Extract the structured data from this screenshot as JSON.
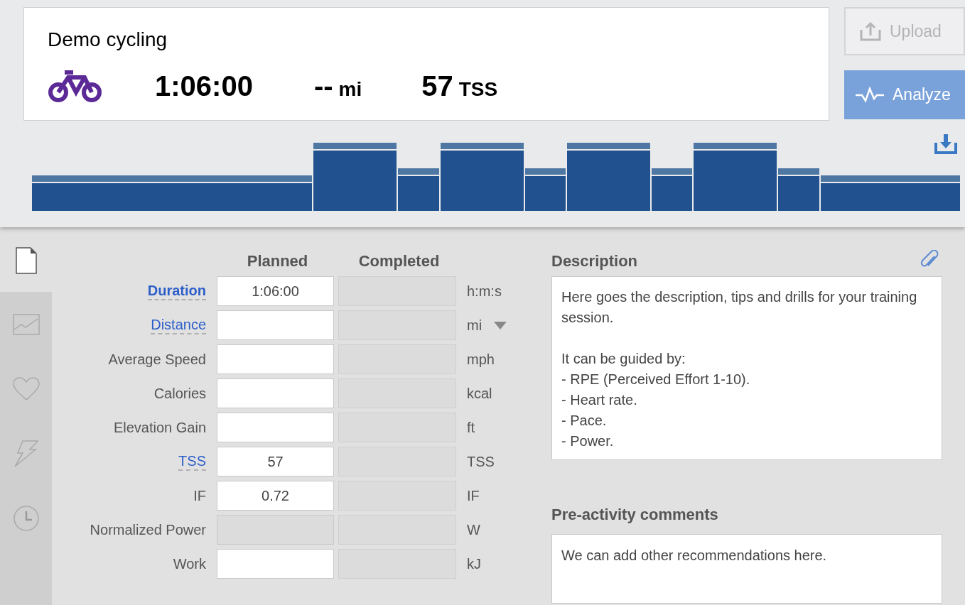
{
  "workout": {
    "title": "Demo cycling",
    "duration": "1:06:00",
    "distance_value": "--",
    "distance_unit": "mi",
    "tss_value": "57",
    "tss_unit": "TSS"
  },
  "buttons": [
    {
      "label": "Upload",
      "disabled": true
    },
    {
      "label": "Analyze",
      "disabled": false
    }
  ],
  "sidebar": [
    {
      "selected": true
    },
    {
      "selected": false
    },
    {
      "selected": false
    },
    {
      "selected": false
    },
    {
      "selected": false
    }
  ],
  "table": {
    "columns": [
      "Planned",
      "Completed"
    ],
    "rows": [
      {
        "label": "Duration",
        "kind": "link",
        "bold": true,
        "planned": "1:06:00",
        "planned_disabled": false,
        "unit": "h:m:s",
        "unit_dropdown": false
      },
      {
        "label": "Distance",
        "kind": "link",
        "bold": false,
        "planned": "",
        "planned_disabled": false,
        "unit": "mi",
        "unit_dropdown": true
      },
      {
        "label": "Average Speed",
        "kind": "plain",
        "bold": false,
        "planned": "",
        "planned_disabled": false,
        "unit": "mph",
        "unit_dropdown": false
      },
      {
        "label": "Calories",
        "kind": "plain",
        "bold": false,
        "planned": "",
        "planned_disabled": false,
        "unit": "kcal",
        "unit_dropdown": false
      },
      {
        "label": "Elevation Gain",
        "kind": "plain",
        "bold": false,
        "planned": "",
        "planned_disabled": false,
        "unit": "ft",
        "unit_dropdown": false
      },
      {
        "label": "TSS",
        "kind": "link",
        "bold": false,
        "planned": "57",
        "planned_disabled": false,
        "unit": "TSS",
        "unit_dropdown": false
      },
      {
        "label": "IF",
        "kind": "plain",
        "bold": false,
        "planned": "0.72",
        "planned_disabled": false,
        "unit": "IF",
        "unit_dropdown": false
      },
      {
        "label": "Normalized Power",
        "kind": "plain",
        "bold": false,
        "planned": "",
        "planned_disabled": true,
        "unit": "W",
        "unit_dropdown": false
      },
      {
        "label": "Work",
        "kind": "plain",
        "bold": false,
        "planned": "",
        "planned_disabled": false,
        "unit": "kJ",
        "unit_dropdown": false
      }
    ]
  },
  "description": {
    "heading": "Description",
    "text": "Here goes the description, tips and drills for your training session.\n\nIt can be guided by:\n- RPE (Perceived Effort 1-10).\n- Heart rate.\n- Pace.\n- Power."
  },
  "comments": {
    "heading": "Pre-activity comments",
    "text": "We can add other recommendations here."
  }
}
